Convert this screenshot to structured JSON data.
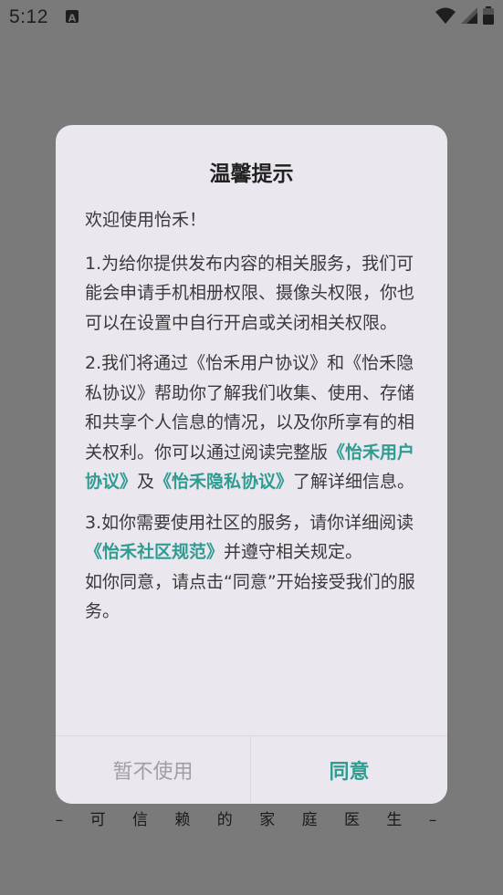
{
  "status_bar": {
    "time": "5:12"
  },
  "background": {
    "tagline": "– 可 信 赖 的 家 庭 医 生 –"
  },
  "dialog": {
    "title": "温馨提示",
    "welcome": "欢迎使用怡禾！",
    "para1": "1.为给你提供发布内容的相关服务，我们可能会申请手机相册权限、摄像头权限，你也可以在设置中自行开启或关闭相关权限。",
    "para2_text": "2.我们将通过《怡禾用户协议》和《怡禾隐私协议》帮助你了解我们收集、使用、存储和共享个人信息的情况，以及你所享有的相关权利。你可以通过阅读完整版",
    "para2_link1": "《怡禾用户协议》",
    "para2_between": "及",
    "para2_link2": "《怡禾隐私协议》",
    "para2_end": "了解详细信息。",
    "para3_text": "3.如你需要使用社区的服务，请你详细阅读",
    "para3_link": "《怡禾社区规范》",
    "para3_end": "并遵守相关规定。",
    "para4": "如你同意，请点击“同意”开始接受我们的服务。",
    "decline_label": "暂不使用",
    "agree_label": "同意"
  },
  "colors": {
    "accent": "#2f9c92",
    "dialog_bg": "#ebe7ef",
    "scrim": "#7a7a7a"
  }
}
